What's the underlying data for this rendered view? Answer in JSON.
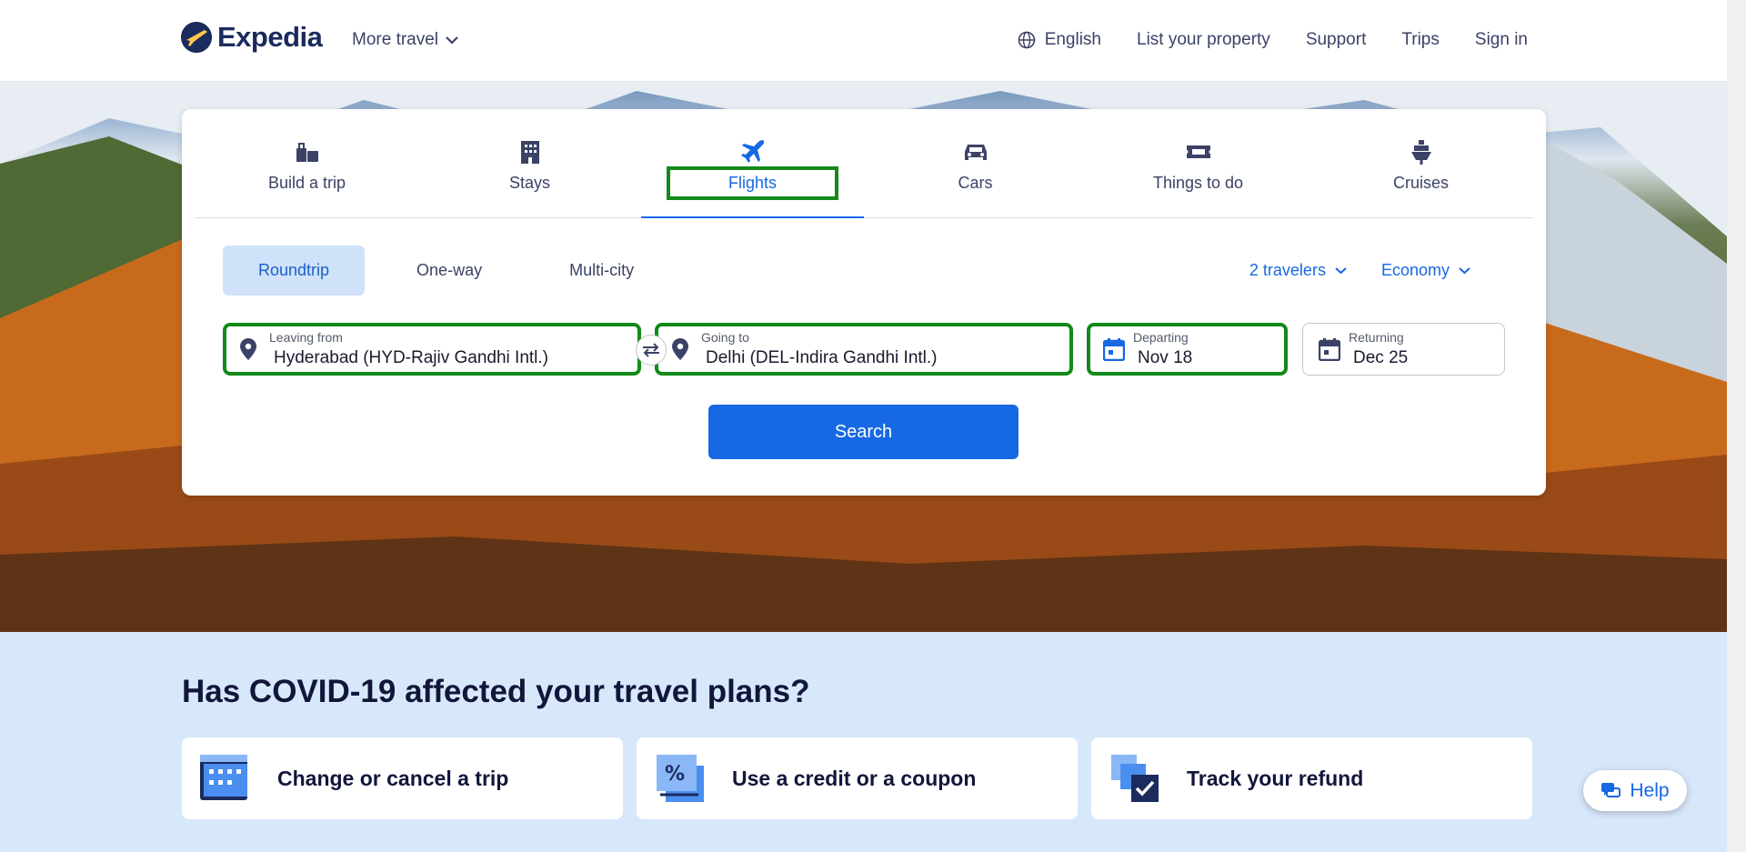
{
  "header": {
    "logo_text": "Expedia",
    "more_travel": "More travel",
    "language": "English",
    "list_property": "List your property",
    "support": "Support",
    "trips": "Trips",
    "sign_in": "Sign in"
  },
  "tabs": [
    {
      "label": "Build a trip",
      "icon": "suitcase-icon"
    },
    {
      "label": "Stays",
      "icon": "building-icon"
    },
    {
      "label": "Flights",
      "icon": "plane-icon",
      "active": true
    },
    {
      "label": "Cars",
      "icon": "car-icon"
    },
    {
      "label": "Things to do",
      "icon": "ticket-icon"
    },
    {
      "label": "Cruises",
      "icon": "ship-icon"
    }
  ],
  "trip_types": [
    "Roundtrip",
    "One-way",
    "Multi-city"
  ],
  "options": {
    "travelers": "2 travelers",
    "cabin": "Economy"
  },
  "fields": {
    "leaving_from": {
      "label": "Leaving from",
      "value": "Hyderabad (HYD-Rajiv Gandhi Intl.)"
    },
    "going_to": {
      "label": "Going to",
      "value": "Delhi (DEL-Indira Gandhi Intl.)"
    },
    "departing": {
      "label": "Departing",
      "value": "Nov 18"
    },
    "returning": {
      "label": "Returning",
      "value": "Dec 25"
    }
  },
  "search_label": "Search",
  "covid": {
    "title": "Has COVID-19 affected your travel plans?",
    "cards": [
      "Change or cancel a trip",
      "Use a credit or a coupon",
      "Track your refund"
    ]
  },
  "help_label": "Help",
  "colors": {
    "brand": "#1b2b5e",
    "accent": "#1668e3",
    "highlight": "#138a1b",
    "covid_bg": "#d8e8fb"
  }
}
